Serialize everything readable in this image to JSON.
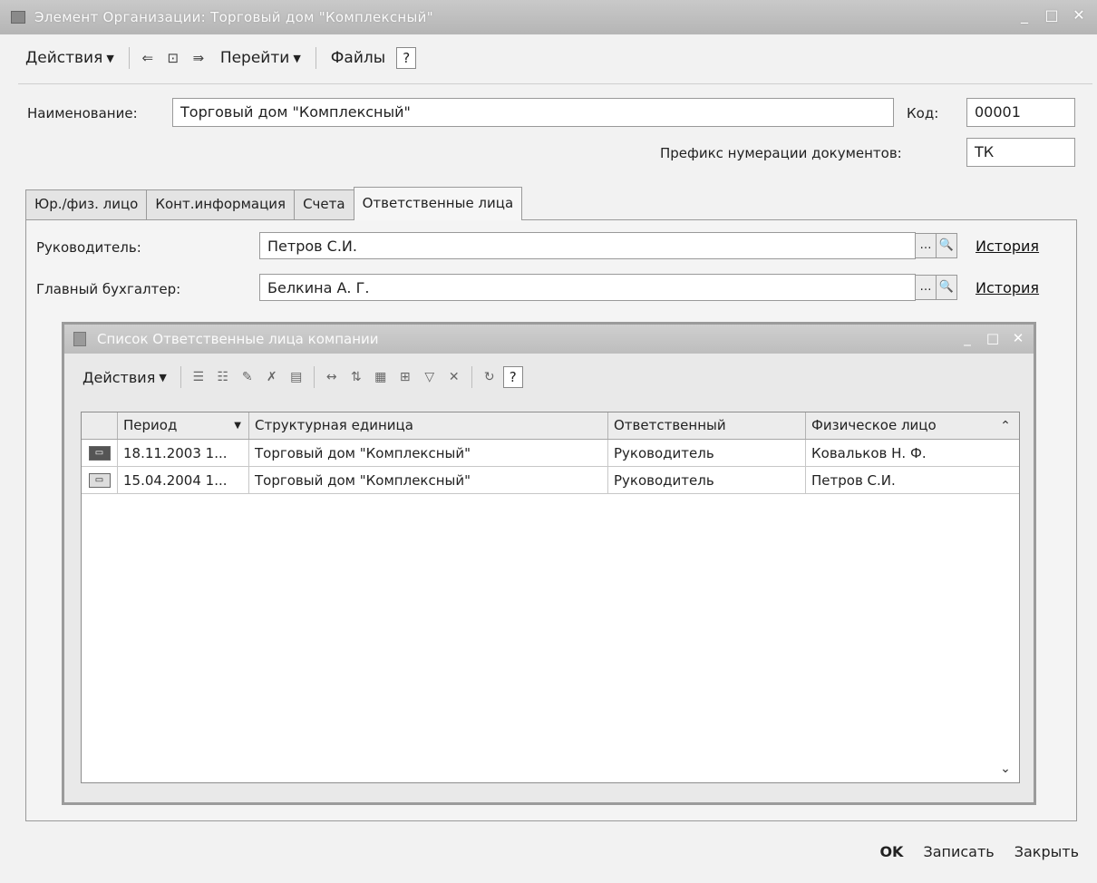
{
  "window": {
    "title": "Элемент Организации: Торговый дом \"Комплексный\"",
    "buttons": {
      "minimize": "_",
      "maximize": "□",
      "close": "✕"
    }
  },
  "toolbar": {
    "actions_label": "Действия",
    "goto_label": "Перейти",
    "files_label": "Файлы",
    "help": "?"
  },
  "form": {
    "name_label": "Наименование:",
    "name_value": "Торговый дом \"Комплексный\"",
    "code_label": "Код:",
    "code_value": "00001",
    "prefix_label": "Префикс нумерации документов:",
    "prefix_value": "ТК"
  },
  "tabs": [
    {
      "label": "Юр./физ. лицо"
    },
    {
      "label": "Конт.информация"
    },
    {
      "label": "Счета"
    },
    {
      "label": "Ответственные лица"
    }
  ],
  "responsible": {
    "head_label": "Руководитель:",
    "head_value": "Петров С.И.",
    "accountant_label": "Главный бухгалтер:",
    "accountant_value": "Белкина А. Г.",
    "history_label": "История"
  },
  "subwindow": {
    "title": "Список Ответственные лица компании",
    "actions_label": "Действия",
    "help": "?",
    "columns": [
      "Период",
      "Структурная единица",
      "Ответственный",
      "Физическое лицо"
    ],
    "rows": [
      {
        "period": "18.11.2003 1...",
        "unit": "Торговый дом \"Комплексный\"",
        "responsible": "Руководитель",
        "person": "Ковальков Н. Ф."
      },
      {
        "period": "15.04.2004 1...",
        "unit": "Торговый дом \"Комплексный\"",
        "responsible": "Руководитель",
        "person": "Петров С.И."
      }
    ]
  },
  "bottom": {
    "ok": "OK",
    "save": "Записать",
    "close": "Закрыть"
  }
}
